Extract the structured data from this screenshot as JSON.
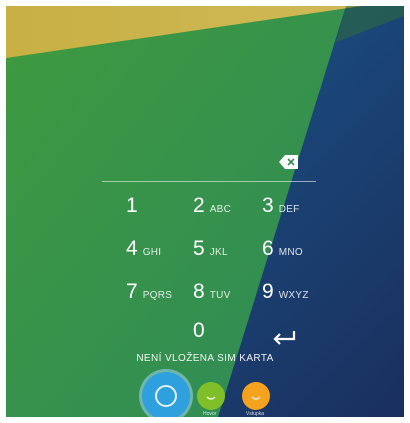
{
  "keypad": {
    "keys": [
      {
        "digit": "1",
        "letters": ""
      },
      {
        "digit": "2",
        "letters": "ABC"
      },
      {
        "digit": "3",
        "letters": "DEF"
      },
      {
        "digit": "4",
        "letters": "GHI"
      },
      {
        "digit": "5",
        "letters": "JKL"
      },
      {
        "digit": "6",
        "letters": "MNO"
      },
      {
        "digit": "7",
        "letters": "PQRS"
      },
      {
        "digit": "8",
        "letters": "TUV"
      },
      {
        "digit": "9",
        "letters": "WXYZ"
      },
      {
        "digit": "0",
        "letters": ""
      }
    ],
    "icons": {
      "backspace": "backspace-icon",
      "enter": "enter-arrow-icon"
    }
  },
  "status": {
    "sim_message": "NENÍ VLOŽENA SIM KARTA"
  },
  "actions": {
    "green_label": "Hovor",
    "orange_label": "Vstupka",
    "unlock_icon": "unlock-ring-icon",
    "colors": {
      "unlock": "#2ea0dd",
      "green": "#7fbf2a",
      "orange": "#f5a21f"
    }
  },
  "wallpaper": {
    "colors": {
      "green": "#3a9a48",
      "gold": "#c9b24a",
      "blue": "#1a3f70"
    }
  }
}
